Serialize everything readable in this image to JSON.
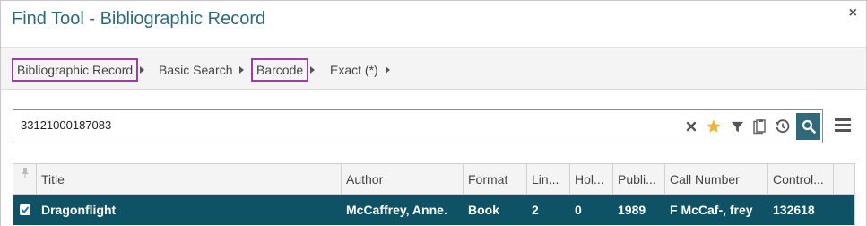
{
  "dialog": {
    "title": "Find Tool - Bibliographic Record",
    "close_label": "×"
  },
  "breadcrumb": [
    {
      "label": "Bibliographic Record",
      "highlighted": true
    },
    {
      "label": "Basic Search",
      "highlighted": false
    },
    {
      "label": "Barcode",
      "highlighted": true
    },
    {
      "label": "Exact (*)",
      "highlighted": false
    }
  ],
  "search": {
    "value": "33121000187083",
    "icons": [
      "clear-icon",
      "favorite-star-icon",
      "filter-icon",
      "clipboard-icon",
      "history-icon",
      "search-icon"
    ]
  },
  "colors": {
    "accent": "#2f6a7c",
    "selected_row": "#0e5266",
    "highlight_border": "#9b3fa1",
    "star": "#f0b429"
  },
  "table": {
    "columns": [
      "Title",
      "Author",
      "Format",
      "Lin...",
      "Hol...",
      "Publi...",
      "Call Number",
      "Control..."
    ],
    "rows": [
      {
        "selected": true,
        "cells": [
          "Dragonflight",
          "McCaffrey, Anne.",
          "Book",
          "2",
          "0",
          "1989",
          "F McCaf-, frey",
          "132618"
        ]
      }
    ]
  }
}
